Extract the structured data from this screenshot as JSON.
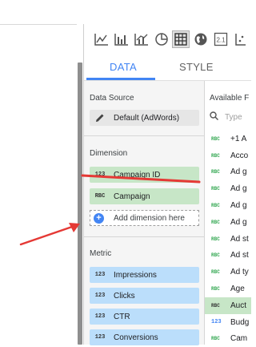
{
  "tabs": {
    "data": "DATA",
    "style": "STYLE"
  },
  "data_source": {
    "title": "Data Source",
    "name": "Default (AdWords)"
  },
  "dimension": {
    "title": "Dimension",
    "fields": [
      {
        "type": "123",
        "name": "Campaign ID"
      },
      {
        "type": "RBC",
        "name": "Campaign"
      }
    ],
    "add_label": "Add dimension here"
  },
  "metric": {
    "title": "Metric",
    "fields": [
      {
        "type": "123",
        "name": "Impressions"
      },
      {
        "type": "123",
        "name": "Clicks"
      },
      {
        "type": "123",
        "name": "CTR"
      },
      {
        "type": "123",
        "name": "Conversions"
      }
    ]
  },
  "available": {
    "title": "Available F",
    "search_placeholder": "Type",
    "items": [
      {
        "type": "RBC",
        "name": "+1 A"
      },
      {
        "type": "RBC",
        "name": "Acco"
      },
      {
        "type": "RBC",
        "name": "Ad g"
      },
      {
        "type": "RBC",
        "name": "Ad g"
      },
      {
        "type": "RBC",
        "name": "Ad g"
      },
      {
        "type": "RBC",
        "name": "Ad g"
      },
      {
        "type": "RBC",
        "name": "Ad st"
      },
      {
        "type": "RBC",
        "name": "Ad st"
      },
      {
        "type": "RBC",
        "name": "Ad ty"
      },
      {
        "type": "RBC",
        "name": "Age"
      },
      {
        "type": "RBC",
        "name": "Auct"
      },
      {
        "type": "123",
        "name": "Budg"
      },
      {
        "type": "RBC",
        "name": "Cam"
      }
    ]
  },
  "colors": {
    "accent": "#4285f4",
    "dimension": "#c7e6c7",
    "metric": "#bbdefb",
    "annotation": "#e53935"
  }
}
